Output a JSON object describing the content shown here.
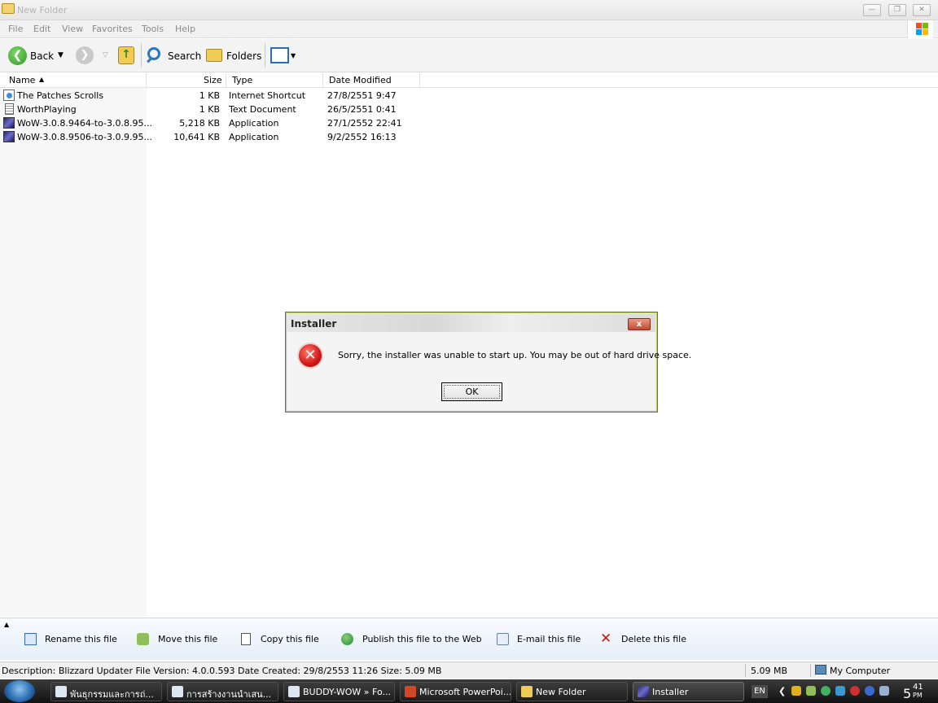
{
  "window": {
    "title": "New Folder"
  },
  "menu": [
    "File",
    "Edit",
    "View",
    "Favorites",
    "Tools",
    "Help"
  ],
  "toolbar": {
    "back": "Back",
    "search": "Search",
    "folders": "Folders"
  },
  "columns": {
    "name": "Name",
    "size": "Size",
    "type": "Type",
    "date": "Date Modified"
  },
  "files": [
    {
      "name": "The Patches Scrolls",
      "size": "1 KB",
      "type": "Internet Shortcut",
      "date": "27/8/2551 9:47"
    },
    {
      "name": "WorthPlaying",
      "size": "1 KB",
      "type": "Text Document",
      "date": "26/5/2551 0:41"
    },
    {
      "name": "WoW-3.0.8.9464-to-3.0.8.95...",
      "size": "5,218 KB",
      "type": "Application",
      "date": "27/1/2552 22:41"
    },
    {
      "name": "WoW-3.0.8.9506-to-3.0.9.95...",
      "size": "10,641 KB",
      "type": "Application",
      "date": "9/2/2552 16:13"
    }
  ],
  "tasks": {
    "rename": "Rename this file",
    "move": "Move this file",
    "copy": "Copy this file",
    "publish": "Publish this file to the Web",
    "email": "E-mail this file",
    "delete": "Delete this file"
  },
  "status": {
    "description": "Description: Blizzard Updater File Version: 4.0.0.593 Date Created: 29/8/2553 11:26 Size: 5.09 MB",
    "size": "5.09 MB",
    "location": "My Computer"
  },
  "dialog": {
    "title": "Installer",
    "message": "Sorry, the installer was unable to start up. You may be out of hard drive space.",
    "ok": "OK",
    "close": "x"
  },
  "taskbar": {
    "items": [
      "พันธุกรรมและการถ่...",
      "การสร้างงานนำเสน...",
      "BUDDY-WOW » Fo...",
      "Microsoft PowerPoi...",
      "New Folder",
      "Installer"
    ],
    "lang": "EN",
    "clock_hour": "5",
    "clock_min": "41",
    "clock_ampm": "PM"
  },
  "colors": {
    "error_red": "#d01818",
    "dialog_border_accent": "#b9cc5f",
    "task_pane_blue": "#e6eef8"
  }
}
